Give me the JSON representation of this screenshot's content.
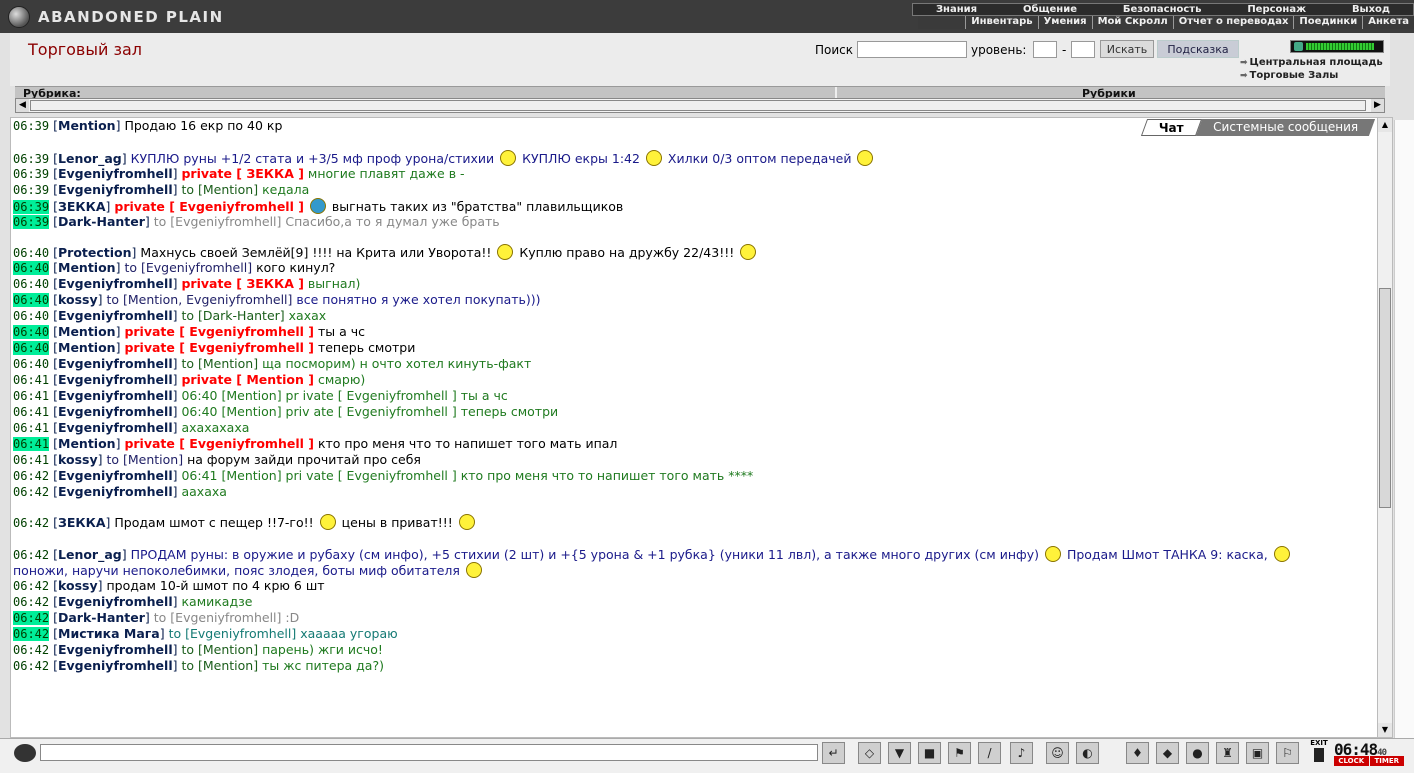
{
  "app": {
    "logo": "ABANDONED PLAIN"
  },
  "menu": {
    "top": [
      "Знания",
      "Общение",
      "Безопасность",
      "Персонаж",
      "Выход"
    ],
    "sub": [
      "Инвентарь",
      "Умения",
      "Мой Скролл",
      "Отчет о переводах",
      "Поединки",
      "Анкета"
    ]
  },
  "header": {
    "title": "Торговый зал",
    "search_label": "Поиск",
    "level_label": "уровень:",
    "level_dash": "-",
    "search_button": "Искать",
    "hint_button": "Подсказка",
    "locations": [
      "Центральная площадь",
      "Торговые Залы"
    ]
  },
  "rubrika": {
    "left": "Рубрика:",
    "right": "Рубрики"
  },
  "chat": {
    "tabs": [
      "Чат",
      "Системные сообщения"
    ],
    "lines": [
      {
        "time": "06:39",
        "hl": false,
        "pre": "",
        "nick": "Mention",
        "parts": [
          {
            "t": "Продаю 16 екр по 40 кр",
            "c": "txt"
          }
        ]
      },
      {
        "time": "06:39",
        "hl": false,
        "pre": "tall",
        "nick": "Lenor_ag",
        "parts": [
          {
            "t": "КУПЛЮ руны +1/2 стата и +3/5 мф проф урона/стихии",
            "c": "txt-blue",
            "sm": true
          },
          {
            "t": "КУПЛЮ екры 1:42",
            "c": "txt-blue",
            "sm": true
          },
          {
            "t": "Хилки 0/3 оптом передачей",
            "c": "txt-blue",
            "sm": true
          }
        ]
      },
      {
        "time": "06:39",
        "hl": false,
        "pre": "",
        "nick": "Evgeniyfromhell",
        "parts": [
          {
            "t": "private [ ЗЕККА ]",
            "c": "prv"
          },
          {
            "t": "многие плавят даже в -",
            "c": "txt-green"
          }
        ]
      },
      {
        "time": "06:39",
        "hl": false,
        "pre": "",
        "nick": "Evgeniyfromhell",
        "parts": [
          {
            "t": "to [Mention]",
            "c": "to"
          },
          {
            "t": "кедала",
            "c": "txt-green"
          }
        ]
      },
      {
        "time": "06:39",
        "hl": true,
        "pre": "",
        "nick": "ЗЕККА",
        "parts": [
          {
            "t": "private [ Evgeniyfromhell ]",
            "c": "prv",
            "sm": "blue"
          },
          {
            "t": "выгнать таких из \"братства\" плавильщиков",
            "c": "txt"
          }
        ]
      },
      {
        "time": "06:39",
        "hl": true,
        "pre": "",
        "nick": "Dark-Hanter",
        "parts": [
          {
            "t": "to [Evgeniyfromhell]",
            "c": "txt-grey"
          },
          {
            "t": "Спасибо,а то я думал уже брать",
            "c": "txt-grey"
          }
        ]
      },
      {
        "time": "06:40",
        "hl": false,
        "pre": "gap",
        "nick": "Protection",
        "parts": [
          {
            "t": "Махнусь своей Землёй[9] !!!! на Крита или Уворота!!",
            "c": "txt",
            "sm": true
          },
          {
            "t": "Куплю право на дружбу 22/43!!!",
            "c": "txt",
            "sm": true
          }
        ]
      },
      {
        "time": "06:40",
        "hl": true,
        "pre": "",
        "nick": "Mention",
        "parts": [
          {
            "t": "to [Evgeniyfromhell]",
            "c": "tofr"
          },
          {
            "t": "кого кинул?",
            "c": "txt"
          }
        ]
      },
      {
        "time": "06:40",
        "hl": false,
        "pre": "",
        "nick": "Evgeniyfromhell",
        "parts": [
          {
            "t": "private [ ЗЕККА ]",
            "c": "prv"
          },
          {
            "t": "выгнал)",
            "c": "txt-green"
          }
        ]
      },
      {
        "time": "06:40",
        "hl": true,
        "pre": "",
        "nick": "kossy",
        "parts": [
          {
            "t": "to [Mention, Evgeniyfromhell]",
            "c": "tofr"
          },
          {
            "t": "все понятно я уже хотел покупать)))",
            "c": "txt-blue"
          }
        ]
      },
      {
        "time": "06:40",
        "hl": false,
        "pre": "",
        "nick": "Evgeniyfromhell",
        "parts": [
          {
            "t": "to [Dark-Hanter]",
            "c": "to"
          },
          {
            "t": "хахах",
            "c": "txt-green"
          }
        ]
      },
      {
        "time": "06:40",
        "hl": true,
        "pre": "",
        "nick": "Mention",
        "parts": [
          {
            "t": "private [ Evgeniyfromhell ]",
            "c": "prv"
          },
          {
            "t": "ты а чс",
            "c": "txt"
          }
        ]
      },
      {
        "time": "06:40",
        "hl": true,
        "pre": "",
        "nick": "Mention",
        "parts": [
          {
            "t": "private [ Evgeniyfromhell ]",
            "c": "prv"
          },
          {
            "t": "теперь смотри",
            "c": "txt"
          }
        ]
      },
      {
        "time": "06:40",
        "hl": false,
        "pre": "",
        "nick": "Evgeniyfromhell",
        "parts": [
          {
            "t": "to [Mention]",
            "c": "to"
          },
          {
            "t": "ща посморим) н очто хотел кинуть-факт",
            "c": "txt-green"
          }
        ]
      },
      {
        "time": "06:41",
        "hl": false,
        "pre": "",
        "nick": "Evgeniyfromhell",
        "parts": [
          {
            "t": "private [ Mention ]",
            "c": "prv"
          },
          {
            "t": "смарю)",
            "c": "txt-green"
          }
        ]
      },
      {
        "time": "06:41",
        "hl": false,
        "pre": "",
        "nick": "Evgeniyfromhell",
        "parts": [
          {
            "t": "06:40 [Mention] pr ivate [ Evgeniyfromhell ] ты а чс",
            "c": "txt-green"
          }
        ]
      },
      {
        "time": "06:41",
        "hl": false,
        "pre": "",
        "nick": "Evgeniyfromhell",
        "parts": [
          {
            "t": "06:40 [Mention] priv ate [ Evgeniyfromhell ] теперь смотри",
            "c": "txt-green"
          }
        ]
      },
      {
        "time": "06:41",
        "hl": false,
        "pre": "",
        "nick": "Evgeniyfromhell",
        "parts": [
          {
            "t": "ахахахаха",
            "c": "txt-green"
          }
        ]
      },
      {
        "time": "06:41",
        "hl": true,
        "pre": "",
        "nick": "Mention",
        "parts": [
          {
            "t": "private [ Evgeniyfromhell ]",
            "c": "prv"
          },
          {
            "t": "кто про меня что то напишет того мать ипал",
            "c": "txt"
          }
        ]
      },
      {
        "time": "06:41",
        "hl": false,
        "pre": "",
        "nick": "kossy",
        "parts": [
          {
            "t": "to [Mention]",
            "c": "tofr"
          },
          {
            "t": "на форум зайди прочитай про себя",
            "c": "txt"
          }
        ]
      },
      {
        "time": "06:42",
        "hl": false,
        "pre": "",
        "nick": "Evgeniyfromhell",
        "parts": [
          {
            "t": "06:41 [Mention] pri vate [ Evgeniyfromhell ] кто про меня что то напишет того мать ****",
            "c": "txt-green"
          }
        ]
      },
      {
        "time": "06:42",
        "hl": false,
        "pre": "",
        "nick": "Evgeniyfromhell",
        "parts": [
          {
            "t": "аахаха",
            "c": "txt-green"
          }
        ]
      },
      {
        "time": "06:42",
        "hl": false,
        "pre": "gap",
        "nick": "ЗЕККА",
        "parts": [
          {
            "t": "Продам шмот с пещер !!7-го!!",
            "c": "txt",
            "sm": true
          },
          {
            "t": "цены в приват!!!",
            "c": "txt",
            "sm": true
          }
        ]
      },
      {
        "time": "06:42",
        "hl": false,
        "pre": "tall",
        "nick": "Lenor_ag",
        "parts": [
          {
            "t": "ПРОДАМ руны: в оружие и рубаху (см инфо), +5 стихии (2 шт) и +{5 урона & +1 рубка} (уники 11 лвл), а также много других (см инфу)",
            "c": "txt-blue",
            "sm": true
          },
          {
            "t": "Продам Шмот ТАНКА 9: каска,",
            "c": "txt-blue",
            "sm": true
          }
        ]
      },
      {
        "time": "",
        "hl": false,
        "pre": "",
        "nick": "",
        "parts": [
          {
            "t": "поножи, наручи непоколебимки, пояс злодея, боты миф обитателя",
            "c": "txt-blue",
            "sm": true
          }
        ]
      },
      {
        "time": "06:42",
        "hl": false,
        "pre": "",
        "nick": "kossy",
        "parts": [
          {
            "t": "продам 10-й шмот по 4 крю 6 шт",
            "c": "txt"
          }
        ]
      },
      {
        "time": "06:42",
        "hl": false,
        "pre": "",
        "nick": "Evgeniyfromhell",
        "parts": [
          {
            "t": "камикадзе",
            "c": "txt-green"
          }
        ]
      },
      {
        "time": "06:42",
        "hl": true,
        "pre": "",
        "nick": "Dark-Hanter",
        "parts": [
          {
            "t": "to [Evgeniyfromhell]",
            "c": "txt-grey"
          },
          {
            "t": ":D",
            "c": "txt-grey"
          }
        ]
      },
      {
        "time": "06:42",
        "hl": true,
        "pre": "",
        "nick": "Мистика Мага",
        "parts": [
          {
            "t": "to [Evgeniyfromhell]",
            "c": "txt-teal"
          },
          {
            "t": "хааааа угораю",
            "c": "txt-teal"
          }
        ]
      },
      {
        "time": "06:42",
        "hl": false,
        "pre": "",
        "nick": "Evgeniyfromhell",
        "parts": [
          {
            "t": "to [Mention]",
            "c": "to"
          },
          {
            "t": "парень) жги исчо!",
            "c": "txt-green"
          }
        ]
      },
      {
        "time": "06:42",
        "hl": false,
        "pre": "",
        "nick": "Evgeniyfromhell",
        "parts": [
          {
            "t": "to [Mention]",
            "c": "to"
          },
          {
            "t": "ты жс питера да?)",
            "c": "txt-green"
          }
        ]
      }
    ]
  },
  "bottom": {
    "clock": "06:48",
    "clock_sec": "40",
    "clock_labels": [
      "CLOCK",
      "TIMER"
    ],
    "exit": "EXIT",
    "toolbar_icons": [
      "enter-icon",
      "eraser-icon",
      "filter-icon",
      "save-icon",
      "runner-icon",
      "translit-icon",
      "music-icon",
      "smile-icon",
      "helmet-icon"
    ],
    "right_icons": [
      "bag-icon",
      "scroll-icon",
      "mask-icon",
      "lantern-icon",
      "lock-icon",
      "flag-icon"
    ]
  },
  "colors": {
    "time_highlight": "#00ee99",
    "private": "#ff0000",
    "title": "#8b0000"
  }
}
